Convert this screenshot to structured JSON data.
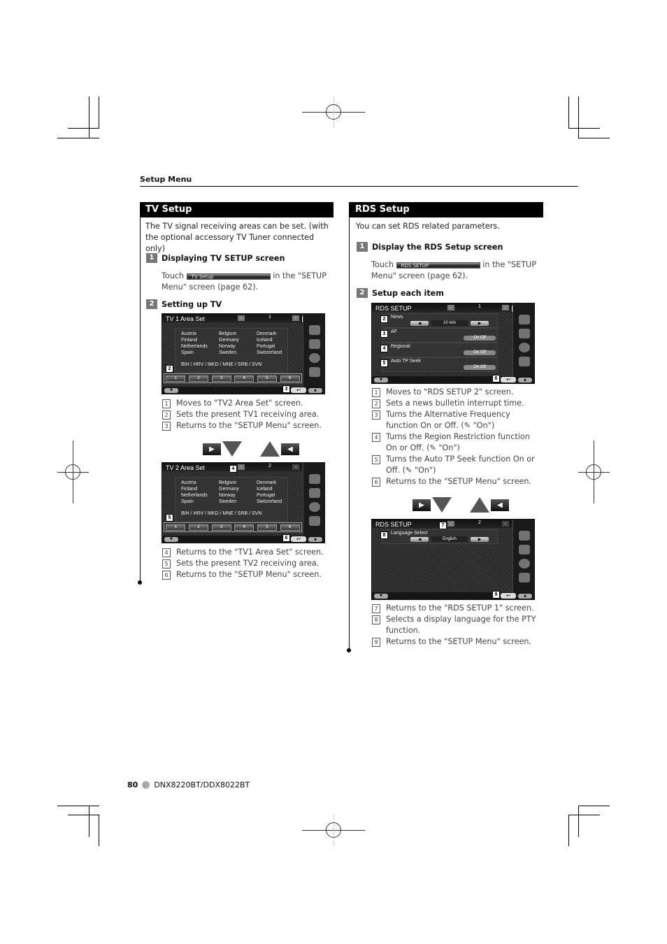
{
  "header": {
    "section": "Setup Menu"
  },
  "tv_setup": {
    "title": "TV Setup",
    "intro": "The TV signal receiving areas can be set. (with the optional accessory TV Tuner connected only)",
    "step1": {
      "num": "1",
      "title": "Displaying TV SETUP screen",
      "touch_pre": "Touch",
      "button_label": "TV Setup",
      "touch_post": "in the \"SETUP Menu\" screen (page 62)."
    },
    "step2": {
      "num": "2",
      "title": "Setting up TV"
    },
    "screen1": {
      "title": "TV 1  Area Set",
      "page": "1",
      "countries": [
        "Austria",
        "Belgium",
        "Denmark",
        "Finland",
        "Germany",
        "Iceland",
        "Netherlands",
        "Norway",
        "Portugal",
        "Spain",
        "Sweden",
        "Switzerland"
      ],
      "footer_line": "BIH / HRV / MKD / MNE / SRB / SVN",
      "presets": [
        "1",
        "2",
        "3",
        "4",
        "5",
        "6"
      ],
      "callouts": [
        "1",
        "2",
        "3"
      ]
    },
    "desc1": [
      {
        "n": "1",
        "text": "Moves to \"TV2 Area Set\" screen."
      },
      {
        "n": "2",
        "text": "Sets the present TV1 receiving area."
      },
      {
        "n": "3",
        "text": "Returns to the \"SETUP Menu\" screen."
      }
    ],
    "screen2": {
      "title": "TV 2  Area Set",
      "page": "2",
      "countries": [
        "Austria",
        "Belgium",
        "Denmark",
        "Finland",
        "Germany",
        "Iceland",
        "Netherlands",
        "Norway",
        "Portugal",
        "Spain",
        "Sweden",
        "Switzerland"
      ],
      "footer_line": "BIH / HRV / MKD / MNE / SRB / SVN",
      "presets": [
        "1",
        "2",
        "3",
        "4",
        "5",
        "6"
      ],
      "callouts": [
        "4",
        "5",
        "6"
      ]
    },
    "desc2": [
      {
        "n": "4",
        "text": "Returns to the \"TV1 Area Set\" screen."
      },
      {
        "n": "5",
        "text": "Sets the present TV2 receiving area."
      },
      {
        "n": "6",
        "text": "Returns to the \"SETUP Menu\" screen."
      }
    ]
  },
  "rds_setup": {
    "title": "RDS Setup",
    "intro": "You can set RDS related parameters.",
    "step1": {
      "num": "1",
      "title": "Display the RDS Setup screen",
      "touch_pre": "Touch",
      "button_label": "RDS SETUP",
      "touch_post": "in the \"SETUP Menu\" screen (page 62)."
    },
    "step2": {
      "num": "2",
      "title": "Setup each item"
    },
    "screen1": {
      "title": "RDS SETUP",
      "page": "1",
      "rows": [
        {
          "callout": "2",
          "label": "News",
          "value": "10 min"
        },
        {
          "callout": "3",
          "label": "AF",
          "toggle": "On   Off"
        },
        {
          "callout": "4",
          "label": "Regional",
          "toggle": "On   Off"
        },
        {
          "callout": "5",
          "label": "Auto TP Seek",
          "toggle": "On   Off"
        }
      ],
      "callouts": [
        "1",
        "6"
      ]
    },
    "desc1": [
      {
        "n": "1",
        "text": "Moves to \"RDS SETUP 2\" screen."
      },
      {
        "n": "2",
        "text": "Sets a news bulletin interrupt time."
      },
      {
        "n": "3",
        "text": "Turns the Alternative Frequency function On or Off. (✎ \"On\")"
      },
      {
        "n": "4",
        "text": "Turns the Region Restriction function On or Off. (✎ \"On\")"
      },
      {
        "n": "5",
        "text": "Turns the Auto TP Seek function On or Off. (✎ \"On\")"
      },
      {
        "n": "6",
        "text": "Returns to the \"SETUP Menu\" screen."
      }
    ],
    "screen2": {
      "title": "RDS SETUP",
      "page": "2",
      "row": {
        "callout": "8",
        "label": "Language Select",
        "value": "English"
      },
      "callouts": [
        "7",
        "9"
      ]
    },
    "desc2": [
      {
        "n": "7",
        "text": "Returns to the \"RDS SETUP 1\" screen."
      },
      {
        "n": "8",
        "text": "Selects a display language for the PTY function."
      },
      {
        "n": "9",
        "text": "Returns to the \"SETUP Menu\" screen."
      }
    ]
  },
  "footer": {
    "page": "80",
    "model": "DNX8220BT/DDX8022BT"
  }
}
